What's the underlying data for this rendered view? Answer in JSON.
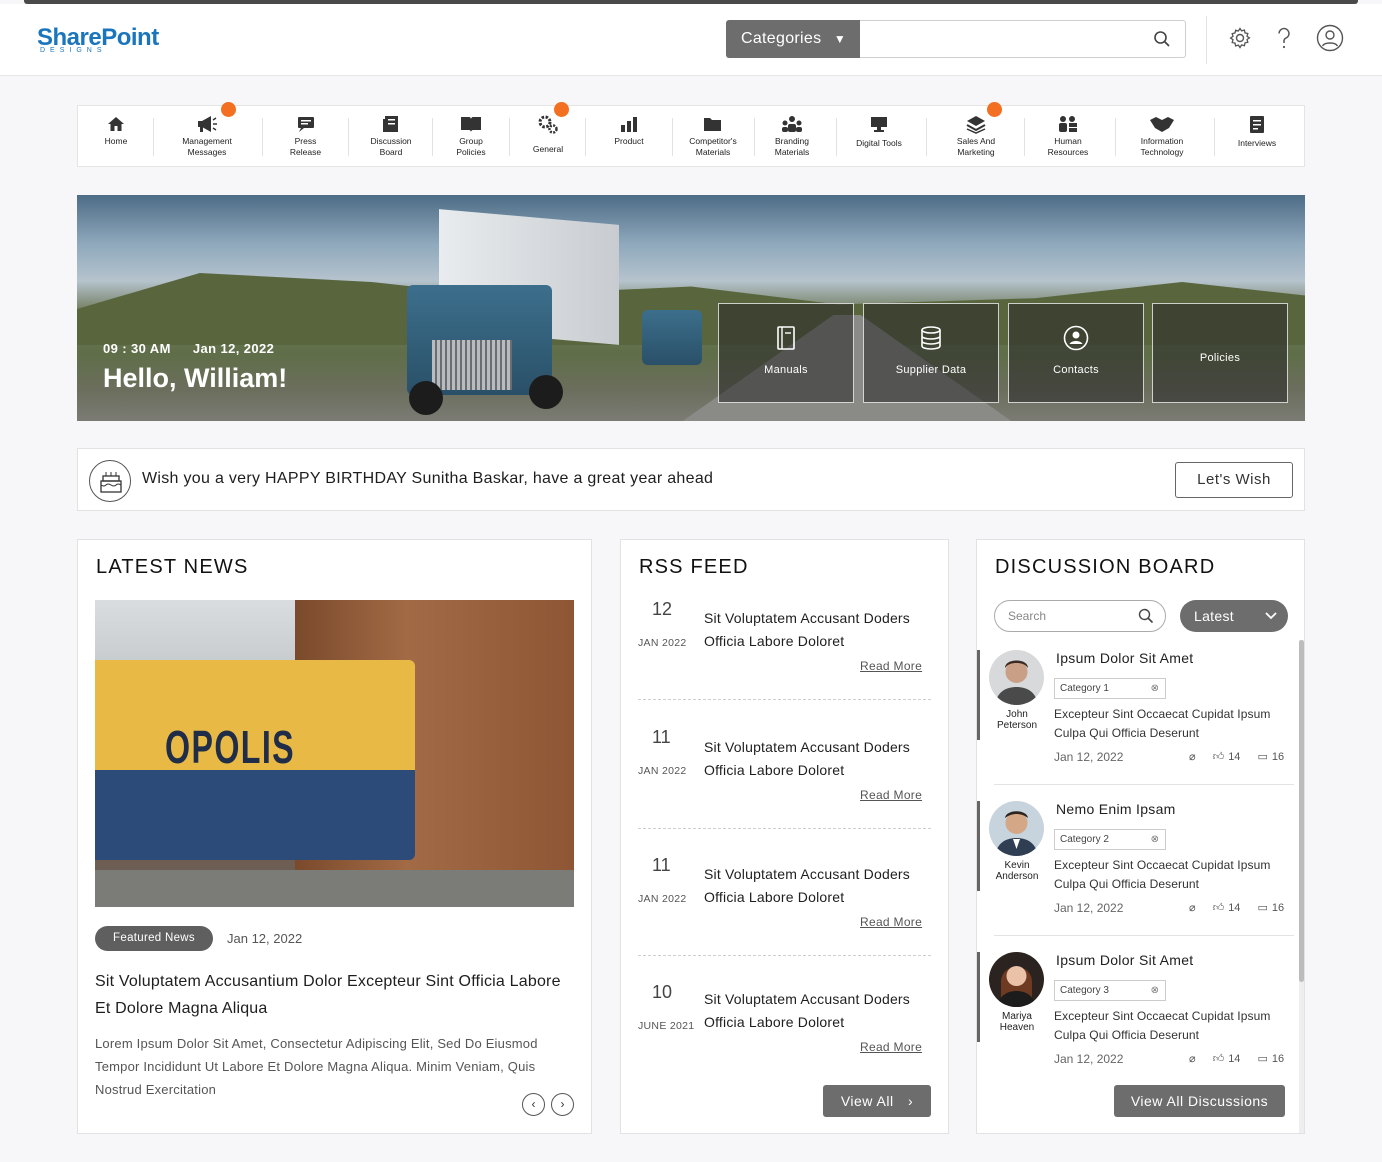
{
  "brand": {
    "logo_main": "SharePoint",
    "logo_sub": "DESIGNS"
  },
  "header": {
    "categories_label": "Categories",
    "search_value": "",
    "icons": [
      "search-icon",
      "gear-icon",
      "help-icon",
      "user-icon"
    ]
  },
  "nav": [
    {
      "label": "Home",
      "icon": "home-icon",
      "badge": false
    },
    {
      "label": "Management Messages",
      "icon": "megaphone-icon",
      "badge": true
    },
    {
      "label": "Press Release",
      "icon": "press-icon",
      "badge": false
    },
    {
      "label": "Discussion Board",
      "icon": "board-icon",
      "badge": false
    },
    {
      "label": "Group Policies",
      "icon": "book-icon",
      "badge": false
    },
    {
      "label": "General",
      "icon": "gears-icon",
      "badge": true
    },
    {
      "label": "Product",
      "icon": "product-icon",
      "badge": false
    },
    {
      "label": "Competitor's Materials",
      "icon": "folder-icon",
      "badge": false
    },
    {
      "label": "Branding Materials",
      "icon": "people-icon",
      "badge": false
    },
    {
      "label": "Digital Tools",
      "icon": "monitor-icon",
      "badge": false
    },
    {
      "label": "Sales And Marketing",
      "icon": "stack-icon",
      "badge": true
    },
    {
      "label": "Human Resources",
      "icon": "hr-icon",
      "badge": false
    },
    {
      "label": "Information Technology",
      "icon": "handshake-icon",
      "badge": false
    },
    {
      "label": "Interviews",
      "icon": "clipboard-icon",
      "badge": false
    }
  ],
  "hero": {
    "time": "09 : 30 AM",
    "date": "Jan 12, 2022",
    "greeting": "Hello, William!",
    "tiles": [
      {
        "label": "Manuals",
        "icon": "manual-icon"
      },
      {
        "label": "Supplier Data",
        "icon": "database-icon"
      },
      {
        "label": "Contacts",
        "icon": "contact-icon"
      },
      {
        "label": "Policies",
        "icon": "policy-icon"
      }
    ]
  },
  "birthday": {
    "message": "Wish you a very HAPPY BIRTHDAY Sunitha Baskar, have a great year ahead",
    "button": "Let's Wish"
  },
  "news": {
    "title": "LATEST NEWS",
    "badge": "Featured News",
    "date": "Jan 12, 2022",
    "headline": "Sit Voluptatem Accusantium Dolor Excepteur Sint Officia Labore Et Dolore Magna Aliqua",
    "body": "Lorem Ipsum Dolor Sit Amet, Consectetur Adipiscing Elit, Sed Do Eiusmod Tempor Incididunt Ut Labore Et Dolore Magna Aliqua.  Minim Veniam, Quis Nostrud Exercitation",
    "image_text": "OPOLIS",
    "prev": "‹",
    "next": "›"
  },
  "rss": {
    "title": "RSS FEED",
    "items": [
      {
        "day": "12",
        "month": "JAN 2022",
        "text": "Sit Voluptatem Accusant Doders Officia Labore Doloret",
        "more": "Read More"
      },
      {
        "day": "11",
        "month": "JAN 2022",
        "text": "Sit Voluptatem Accusant Doders Officia Labore Doloret",
        "more": "Read More"
      },
      {
        "day": "11",
        "month": "JAN 2022",
        "text": "Sit Voluptatem Accusant Doders Officia Labore Doloret",
        "more": "Read More"
      },
      {
        "day": "10",
        "month": "JUNE 2021",
        "text": "Sit Voluptatem Accusant Doders Officia Labore Doloret",
        "more": "Read More"
      }
    ],
    "view_all": "View All"
  },
  "discussion": {
    "title": "DISCUSSION BOARD",
    "search_placeholder": "Search",
    "filter": "Latest",
    "items": [
      {
        "title": "Ipsum Dolor Sit Amet",
        "author": "John Peterson",
        "category": "Category 1",
        "desc": "Excepteur Sint Occaecat Cupidat Ipsum Culpa Qui Officia Deserunt",
        "date": "Jan 12, 2022",
        "likes": "14",
        "comments": "16"
      },
      {
        "title": "Nemo Enim Ipsam",
        "author": "Kevin Anderson",
        "category": "Category 2",
        "desc": "Excepteur Sint Occaecat Cupidat Ipsum Culpa Qui Officia Deserunt",
        "date": "Jan 12, 2022",
        "likes": "14",
        "comments": "16"
      },
      {
        "title": "Ipsum Dolor Sit Amet",
        "author": "Mariya Heaven",
        "category": "Category 3",
        "desc": "Excepteur Sint Occaecat Cupidat Ipsum Culpa Qui Officia Deserunt",
        "date": "Jan 12, 2022",
        "likes": "14",
        "comments": "16"
      }
    ],
    "view_all": "View All Discussions"
  },
  "colors": {
    "accent": "#6d6d6d",
    "badge": "#f36f21",
    "logo_blue": "#1b75bc",
    "logo_green": "#8dc63f"
  }
}
